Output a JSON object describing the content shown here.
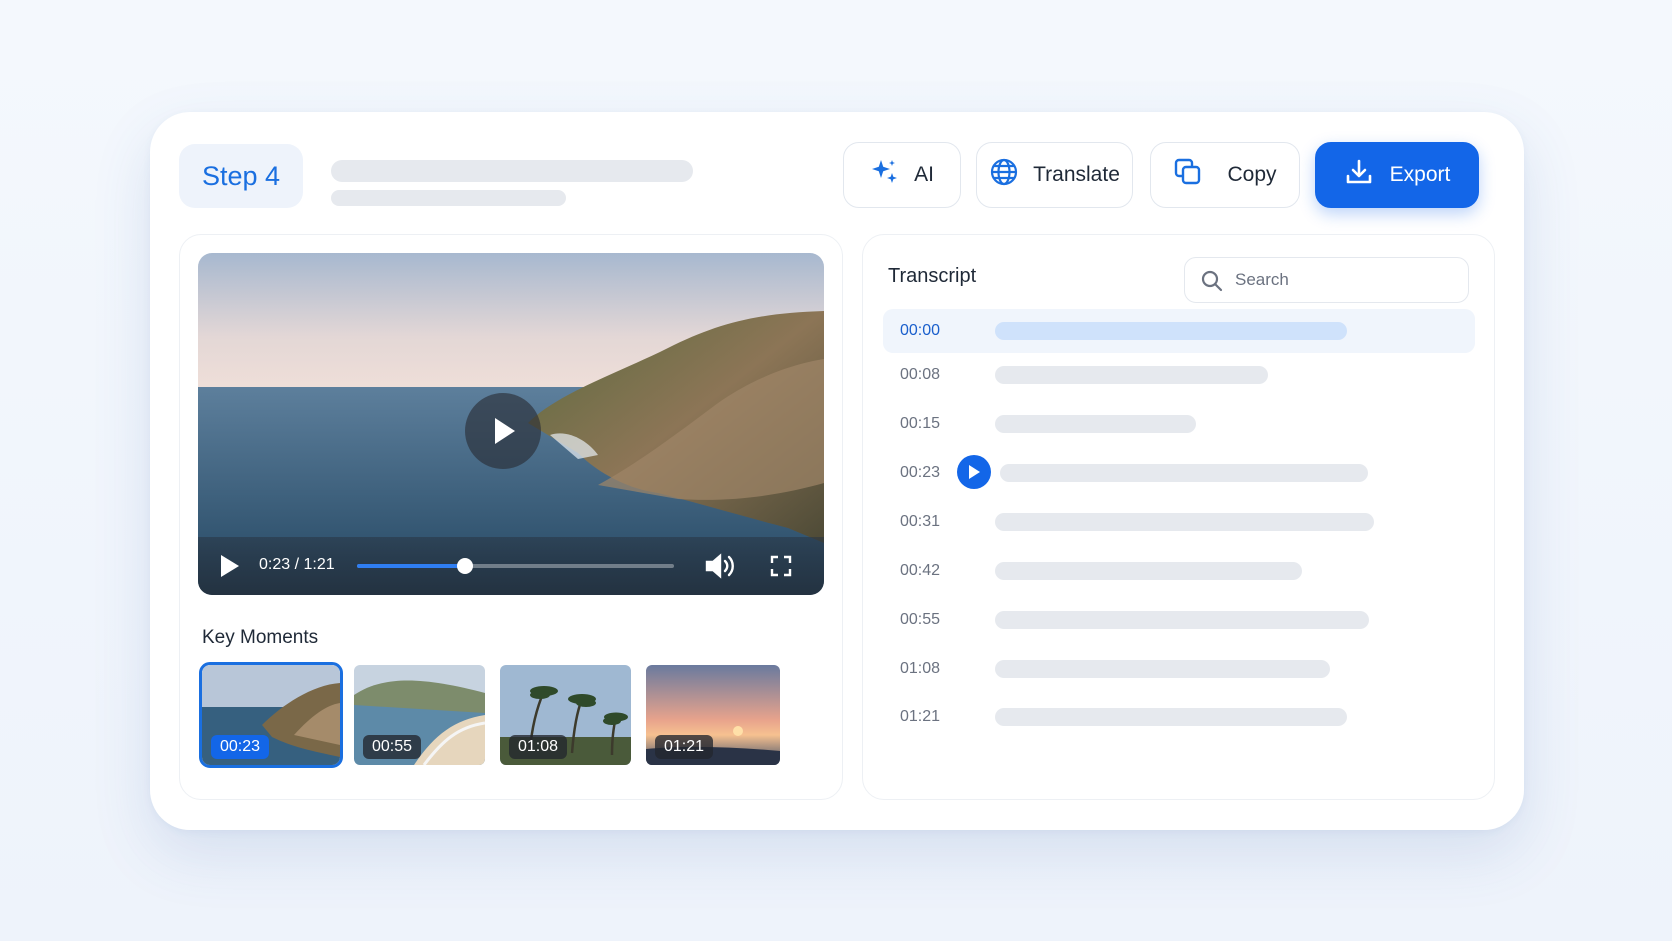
{
  "header": {
    "step_label": "Step 4",
    "buttons": [
      {
        "label": "AI",
        "icon": "sparkle-icon"
      },
      {
        "label": "Translate",
        "icon": "globe-icon"
      },
      {
        "label": "Copy",
        "icon": "copy-icon"
      },
      {
        "label": "Export",
        "icon": "download-icon"
      }
    ]
  },
  "colors": {
    "accent": "#1366e8",
    "accent_text": "#1a6fe0",
    "skeleton": "#e6e9ee",
    "active_row": "#f0f5fc"
  },
  "player": {
    "time": "0:23 / 1:21",
    "progress": 0.34,
    "icons": [
      "play-icon",
      "volume-icon",
      "fullscreen-icon"
    ]
  },
  "key_moments": {
    "title": "Key Moments",
    "items": [
      {
        "time": "00:23",
        "active": true
      },
      {
        "time": "00:55",
        "active": false
      },
      {
        "time": "01:08",
        "active": false
      },
      {
        "time": "01:21",
        "active": false
      }
    ]
  },
  "transcript": {
    "title": "Transcript",
    "search_placeholder": "Search",
    "rows": [
      {
        "time": "00:00",
        "active": true,
        "playing": false,
        "text_fill": 0.63
      },
      {
        "time": "00:08",
        "active": false,
        "playing": false,
        "text_fill": 0.49
      },
      {
        "time": "00:15",
        "active": false,
        "playing": false,
        "text_fill": 0.36
      },
      {
        "time": "00:23",
        "active": false,
        "playing": true,
        "text_fill": 0.66
      },
      {
        "time": "00:31",
        "active": false,
        "playing": false,
        "text_fill": 0.68
      },
      {
        "time": "00:42",
        "active": false,
        "playing": false,
        "text_fill": 0.55
      },
      {
        "time": "00:55",
        "active": false,
        "playing": false,
        "text_fill": 0.67
      },
      {
        "time": "01:08",
        "active": false,
        "playing": false,
        "text_fill": 0.6
      },
      {
        "time": "01:21",
        "active": false,
        "playing": false,
        "text_fill": 0.63
      }
    ]
  }
}
